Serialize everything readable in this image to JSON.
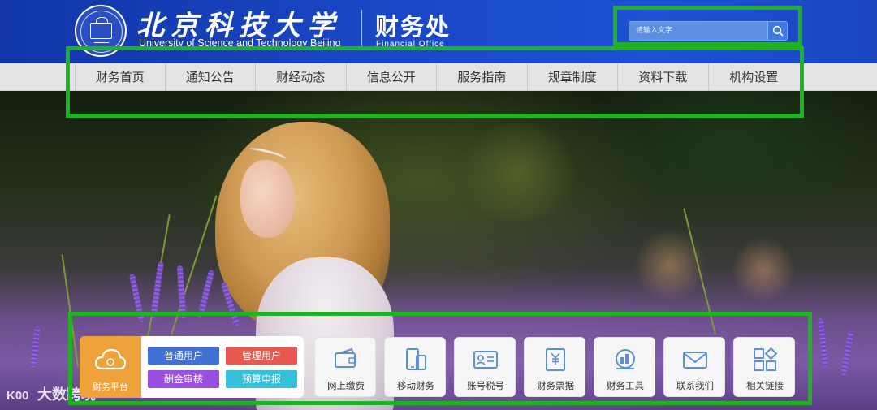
{
  "header": {
    "university_cn": "北京科技大学",
    "university_en": "University of Science and Technology Beijing",
    "office_cn": "财务处",
    "office_en": "Financial Office"
  },
  "search": {
    "placeholder": "请输入文字",
    "button_icon": "search-icon"
  },
  "nav": {
    "items": [
      {
        "label": "财务首页"
      },
      {
        "label": "通知公告"
      },
      {
        "label": "财经动态"
      },
      {
        "label": "信息公开"
      },
      {
        "label": "服务指南"
      },
      {
        "label": "规章制度"
      },
      {
        "label": "资料下载"
      },
      {
        "label": "机构设置"
      }
    ]
  },
  "quick": {
    "platform": {
      "label": "财务平台",
      "icon": "cloud-icon",
      "color": "#f0a23a"
    },
    "user_buttons": [
      {
        "label": "普通用户",
        "color": "#3e70d6"
      },
      {
        "label": "管理用户",
        "color": "#e8594f"
      },
      {
        "label": "酬金审核",
        "color": "#9b4fe0"
      },
      {
        "label": "预算申报",
        "color": "#35bfd8"
      }
    ],
    "tiles": [
      {
        "label": "网上缴费",
        "icon": "wallet-icon"
      },
      {
        "label": "移动财务",
        "icon": "mobile-icon"
      },
      {
        "label": "账号税号",
        "icon": "id-card-icon"
      },
      {
        "label": "财务票据",
        "icon": "receipt-icon"
      },
      {
        "label": "财务工具",
        "icon": "calculator-icon"
      },
      {
        "label": "联系我们",
        "icon": "mail-icon"
      },
      {
        "label": "相关链接",
        "icon": "grid-icon"
      }
    ]
  },
  "watermark": {
    "text": "大数跨境",
    "mark": "K00"
  },
  "colors": {
    "header_blue": "#1a46c0",
    "highlight_green": "#1fb321",
    "icon_blue": "#5b8fd6"
  }
}
